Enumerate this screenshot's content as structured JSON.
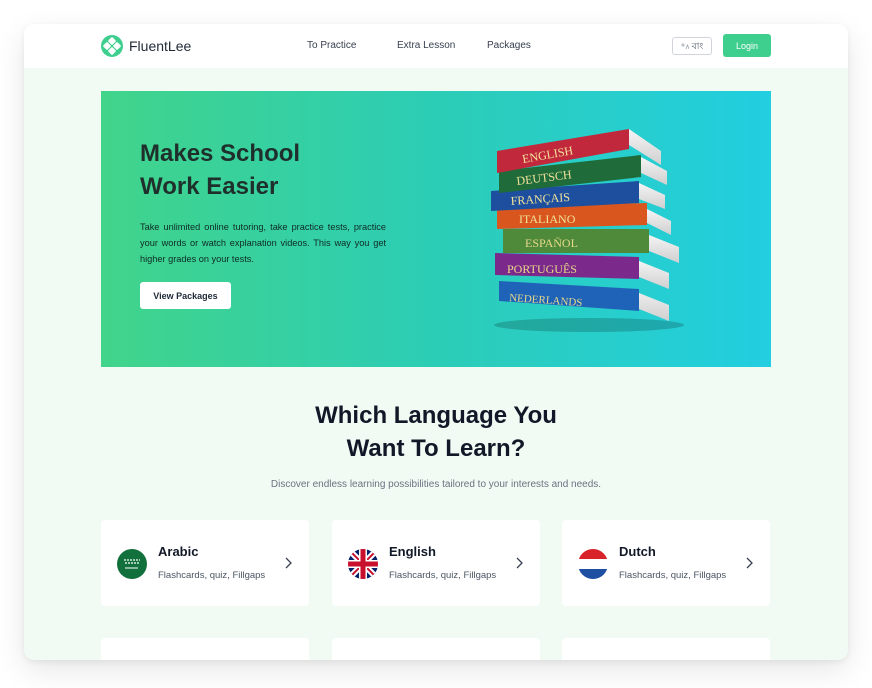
{
  "header": {
    "logo_text": "FluentLee",
    "nav": [
      "To Practice",
      "Extra Lesson",
      "Packages"
    ],
    "lang_label": "বাং",
    "login_label": "Login"
  },
  "hero": {
    "title_line1": "Makes School",
    "title_line2": "Work Easier",
    "description": "Take unlimited online tutoring, take practice tests, practice your words or watch explanation videos. This way you get higher grades on your tests.",
    "button_label": "View Packages",
    "book_titles": [
      "ENGLISH",
      "DEUTSCH",
      "FRANÇAIS",
      "ITALIANO",
      "ESPAÑOL",
      "PORTUGUÊS",
      "NEDERLANDS"
    ]
  },
  "section": {
    "title_line1": "Which Language You",
    "title_line2": "Want To Learn?",
    "subtitle": "Discover endless learning possibilities tailored to your interests and needs."
  },
  "languages": [
    {
      "name": "Arabic",
      "desc": "Flashcards, quiz, Fillgaps",
      "flag_icon": "saudi-flag-icon"
    },
    {
      "name": "English",
      "desc": "Flashcards, quiz, Fillgaps",
      "flag_icon": "uk-flag-icon"
    },
    {
      "name": "Dutch",
      "desc": "Flashcards, quiz, Fillgaps",
      "flag_icon": "netherlands-flag-icon"
    }
  ],
  "colors": {
    "accent": "#3ecf8e",
    "hero_gradient_start": "#41d48a",
    "hero_gradient_end": "#22cee0",
    "page_bg": "#f1fbf4"
  }
}
